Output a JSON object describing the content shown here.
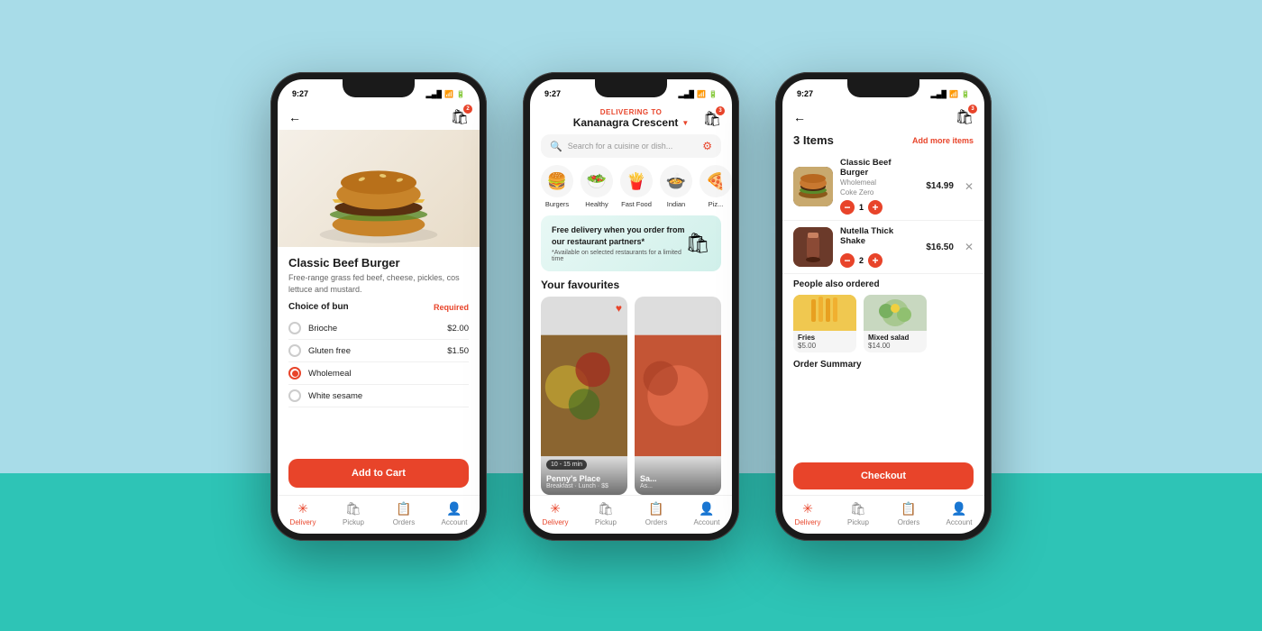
{
  "phones": {
    "status_time": "9:27",
    "signal": "●●●",
    "wifi": "WiFi",
    "battery": "⬛"
  },
  "phone1": {
    "back_icon": "←",
    "cart_icon": "🛍",
    "cart_count": "2",
    "item_name": "Classic Beef Burger",
    "item_desc": "Free-range grass fed beef, cheese, pickles, cos lettuce and mustard.",
    "choice_title": "Choice of bun",
    "required_label": "Required",
    "options": [
      {
        "label": "Brioche",
        "price": "$2.00",
        "selected": false
      },
      {
        "label": "Gluten free",
        "price": "$1.50",
        "selected": false
      },
      {
        "label": "Wholemeal",
        "price": "",
        "selected": true
      },
      {
        "label": "White sesame",
        "price": "",
        "selected": false
      }
    ],
    "add_to_cart": "Add to Cart",
    "nav": {
      "delivery": "Delivery",
      "pickup": "Pickup",
      "orders": "Orders",
      "account": "Account"
    }
  },
  "phone2": {
    "delivering_to": "DELIVERING TO",
    "location": "Kananagra Crescent",
    "search_placeholder": "Search for a cuisine or dish...",
    "cart_count": "3",
    "categories": [
      {
        "emoji": "🍔",
        "label": "Burgers"
      },
      {
        "emoji": "🥗",
        "label": "Healthy"
      },
      {
        "emoji": "🍟",
        "label": "Fast Food"
      },
      {
        "emoji": "🍲",
        "label": "Indian"
      },
      {
        "emoji": "🍕",
        "label": "Piz..."
      }
    ],
    "promo_title": "Free delivery when you order from our restaurant partners*",
    "promo_sub": "*Available on selected restaurants for a limited time",
    "favourites_title": "Your favourites",
    "fav1": {
      "name": "Penny's Place",
      "sub": "Breakfast · Lunch · $$",
      "time": "10 - 15 min"
    },
    "fav2": {
      "name": "Sa...",
      "sub": "As..."
    },
    "nav": {
      "delivery": "Delivery",
      "pickup": "Pickup",
      "orders": "Orders",
      "account": "Account"
    }
  },
  "phone3": {
    "back_icon": "←",
    "cart_icon": "🛍",
    "cart_count": "3",
    "items_count": "3 Items",
    "add_more": "Add more items",
    "items": [
      {
        "name": "Classic Beef Burger",
        "sub1": "Wholemeal",
        "sub2": "Coke Zero",
        "qty": "1",
        "price": "$14.99"
      },
      {
        "name": "Nutella Thick Shake",
        "sub1": "",
        "sub2": "",
        "qty": "2",
        "price": "$16.50"
      }
    ],
    "people_also_title": "People also ordered",
    "suggestions": [
      {
        "name": "Fries",
        "price": "$5.00"
      },
      {
        "name": "Mixed salad",
        "price": "$14.00"
      }
    ],
    "order_summary": "Order Summary",
    "checkout": "Checkout",
    "nav": {
      "delivery": "Delivery",
      "pickup": "Pickup",
      "orders": "Orders",
      "account": "Account"
    }
  }
}
